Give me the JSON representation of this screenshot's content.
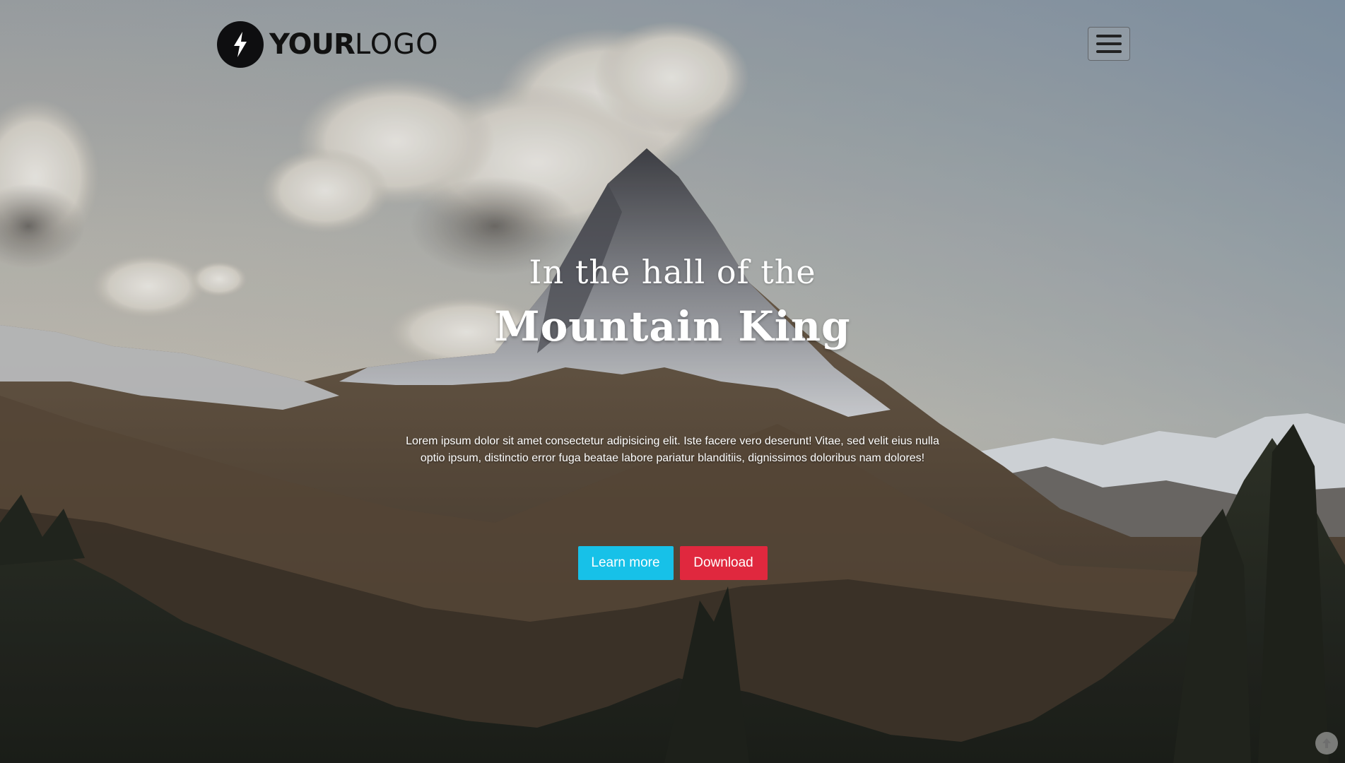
{
  "brand": {
    "logo_icon": "lightning-bolt-icon",
    "logo_bold": "YOUR",
    "logo_light": "LOGO"
  },
  "nav": {
    "menu_icon": "hamburger-menu-icon"
  },
  "hero": {
    "headline_line1": "In the hall of the",
    "headline_line2": "Mountain King",
    "lead": "Lorem ipsum dolor sit amet consectetur adipisicing elit. Iste facere vero deserunt! Vitae, sed velit eius nulla optio ipsum, distinctio error fuga beatae labore pariatur blanditiis, dignissimos doloribus nam dolores!",
    "buttons": {
      "learn_more": "Learn more",
      "download": "Download"
    }
  },
  "scroll_top": {
    "icon": "arrow-up-circle-icon"
  },
  "colors": {
    "learn_more_bg": "#17c1e8",
    "download_bg": "#e0283e",
    "logo_badge": "#0e0e10"
  }
}
